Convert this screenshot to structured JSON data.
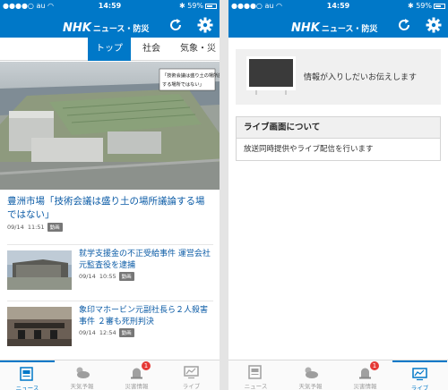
{
  "status_bar": {
    "carrier": "au",
    "time": "14:59",
    "battery": "59%"
  },
  "header": {
    "logo": "NHK",
    "title": "ニュース・防災"
  },
  "tabs": [
    "トップ",
    "社会",
    "気象・災"
  ],
  "hero": {
    "overlay_line1": "「技術会議は盛り土の場所議論",
    "overlay_line2": "する場所ではない」"
  },
  "headline": {
    "title": "豊洲市場「技術会議は盛り土の場所議論する場ではない」",
    "date": "09/14",
    "time": "11:51",
    "badge": "動画"
  },
  "articles": [
    {
      "title": "就学支援金の不正受給事件 運営会社元監査役を逮捕",
      "date": "09/14",
      "time": "10:55",
      "badge": "動画"
    },
    {
      "title": "象印マホービン元副社長ら２人殺害事件 ２審も死刑判決",
      "date": "09/14",
      "time": "12:54",
      "badge": "動画"
    }
  ],
  "tabbar": {
    "items": [
      {
        "label": "ニュース",
        "icon": "news-icon"
      },
      {
        "label": "天気予報",
        "icon": "weather-icon"
      },
      {
        "label": "災害情報",
        "icon": "disaster-icon"
      },
      {
        "label": "ライブ",
        "icon": "live-tv-icon"
      }
    ],
    "disaster_badge": "1"
  },
  "live": {
    "message": "情報が入りしだいお伝えします",
    "about_title": "ライブ画面について",
    "about_body": "放送同時提供やライブ配信を行います"
  },
  "colors": {
    "brand": "#0078c8",
    "headline": "#0b5ba6",
    "badge": "#e53935"
  }
}
